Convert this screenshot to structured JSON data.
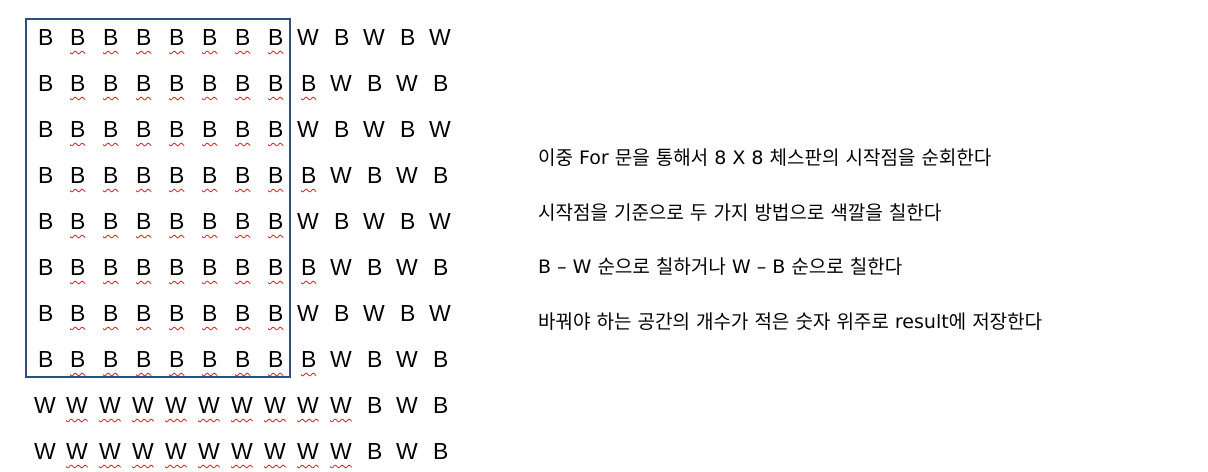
{
  "grid": {
    "rows": [
      [
        "B",
        "B",
        "B",
        "B",
        "B",
        "B",
        "B",
        "B",
        "W",
        "B",
        "W",
        "B",
        "W"
      ],
      [
        "B",
        "B",
        "B",
        "B",
        "B",
        "B",
        "B",
        "B",
        "B",
        "W",
        "B",
        "W",
        "B"
      ],
      [
        "B",
        "B",
        "B",
        "B",
        "B",
        "B",
        "B",
        "B",
        "W",
        "B",
        "W",
        "B",
        "W"
      ],
      [
        "B",
        "B",
        "B",
        "B",
        "B",
        "B",
        "B",
        "B",
        "B",
        "W",
        "B",
        "W",
        "B"
      ],
      [
        "B",
        "B",
        "B",
        "B",
        "B",
        "B",
        "B",
        "B",
        "W",
        "B",
        "W",
        "B",
        "W"
      ],
      [
        "B",
        "B",
        "B",
        "B",
        "B",
        "B",
        "B",
        "B",
        "B",
        "W",
        "B",
        "W",
        "B"
      ],
      [
        "B",
        "B",
        "B",
        "B",
        "B",
        "B",
        "B",
        "B",
        "W",
        "B",
        "W",
        "B",
        "W"
      ],
      [
        "B",
        "B",
        "B",
        "B",
        "B",
        "B",
        "B",
        "B",
        "B",
        "W",
        "B",
        "W",
        "B"
      ],
      [
        "W",
        "W",
        "W",
        "W",
        "W",
        "W",
        "W",
        "W",
        "W",
        "W",
        "B",
        "W",
        "B"
      ],
      [
        "W",
        "W",
        "W",
        "W",
        "W",
        "W",
        "W",
        "W",
        "W",
        "W",
        "B",
        "W",
        "B"
      ]
    ],
    "frame_color": "#2f4f7f",
    "squiggle_color": "#d02020"
  },
  "notes": [
    "이중 For 문을 통해서 8 X 8 체스판의 시작점을 순회한다",
    "시작점을 기준으로 두 가지 방법으로 색깔을 칠한다",
    "B – W 순으로 칠하거나 W – B 순으로 칠한다",
    "바꿔야 하는 공간의 개수가 적은 숫자 위주로 result에 저장한다"
  ]
}
